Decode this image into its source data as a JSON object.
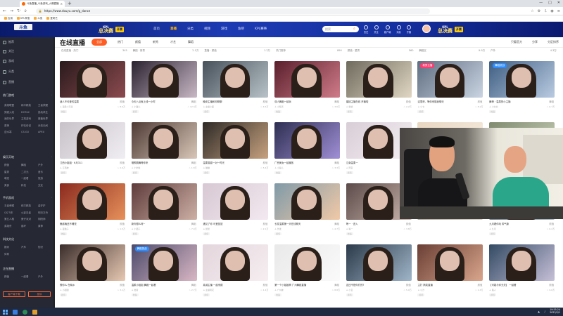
{
  "browser": {
    "tab_title": "斗鱼直播_斗鱼游戏_火爆直播",
    "url": "https://www.douyu.com/g_dance",
    "bookmarks": [
      "应用",
      "KPL押宝",
      "斗鱼",
      "爱奇艺"
    ]
  },
  "header": {
    "logo": "斗鱼",
    "room_number": "69190",
    "kpl_left": {
      "line1": "KPL",
      "line2": "总决赛",
      "tag": "开赛"
    },
    "kpl_right": {
      "line1": "KPL",
      "line2": "总决赛",
      "tag": "开赛"
    },
    "nav": [
      "首页",
      "直播",
      "分类",
      "视频",
      "游戏",
      "鱼吧",
      "KPL赛事"
    ],
    "active_nav": "直播",
    "search_placeholder": "搜索",
    "icons": [
      "历史",
      "关注",
      "客户端",
      "消息",
      "开播"
    ]
  },
  "sidebar": {
    "items": [
      "推荐",
      "关注",
      "游戏",
      "分类",
      "直播"
    ],
    "sections": [
      {
        "title": "热门游戏",
        "cells": [
          "英雄联盟",
          "和平精英",
          "王者荣耀",
          "穿越火线",
          "DOTA2",
          "绝地求生",
          "我的世界",
          "主机游戏",
          "魔兽世界",
          "原神",
          "炉石传说",
          "永劫无间",
          "逆水寒",
          "CS:GO",
          "APEX"
        ]
      },
      {
        "title": "娱乐天地",
        "cells": [
          "颜值",
          "舞蹈",
          "户外",
          "星秀",
          "二次元",
          "音乐",
          "萌宠",
          "一起看",
          "旅游",
          "美食",
          "科技",
          "交友"
        ]
      },
      {
        "title": "手机游戏",
        "cells": [
          "王者荣耀",
          "和平精英",
          "金铲铲",
          "QQ飞车",
          "火影忍者",
          "明日方舟",
          "第五人格",
          "蛋仔派对",
          "阴阳师",
          "英雄杀",
          "崩坏",
          "原神"
        ]
      },
      {
        "title": "科技文化",
        "cells": [
          "数码",
          "汽车",
          "知识",
          "体育"
        ]
      },
      {
        "title": "正在直播",
        "cells": [
          "颜值",
          "一起看",
          "户外"
        ]
      }
    ],
    "buttons": [
      "客户端下载",
      "投诉"
    ]
  },
  "main": {
    "title": "在线直播",
    "filters": [
      "全部",
      "热门",
      "颜值",
      "新秀",
      "才艺",
      "舞蹈"
    ],
    "active_filter": "全部",
    "right_actions": [
      "只看官方",
      "分享",
      "分区排序"
    ],
    "top_row": [
      {
        "a": "在线直播 · 热门",
        "b": "345"
      },
      {
        "a": "舞蹈 · 新秀",
        "b": "2.1万"
      },
      {
        "a": "直播 · 颜值",
        "b": "1.2万"
      },
      {
        "a": "热门推荐",
        "b": "890"
      },
      {
        "a": "颜值 · 星秀",
        "b": "560"
      },
      {
        "a": "舞蹈区",
        "b": "9.9万"
      },
      {
        "a": "户外",
        "b": "4.3万"
      }
    ],
    "cards": [
      {
        "title": "迷人不可爱的温柔",
        "tag": "颜值",
        "anchor": "温柔小可爱",
        "viewers": "8.6万",
        "label": "舞蹈",
        "badge": "",
        "c1": "#2a1a1c",
        "c2": "#8c4b4f"
      },
      {
        "title": "今天八点就上线一小时",
        "tag": "舞蹈",
        "anchor": "小甜心",
        "viewers": "12.3万",
        "label": "颜值",
        "badge": "",
        "c1": "#2a2230",
        "c2": "#c9b8c6"
      },
      {
        "title": "晚安主播和你聊聊",
        "tag": "颜值",
        "anchor": "主播小鹿",
        "viewers": "4.5万",
        "label": "颜值",
        "badge": "",
        "c1": "#46515a",
        "c2": "#b8c2c8"
      },
      {
        "title": "双人舞蹈一起玩",
        "tag": "舞蹈",
        "anchor": "小晴天",
        "viewers": "3.6万",
        "label": "舞蹈",
        "badge": "",
        "c1": "#5a1f2c",
        "c2": "#d07b89"
      },
      {
        "title": "蜜桃主播在线 开播啦",
        "tag": "颜值",
        "anchor": "蜜桃",
        "viewers": "2.2万",
        "label": "颜值",
        "badge": "",
        "c1": "#6e6a5d",
        "c2": "#e0d6c2"
      },
      {
        "title": "这里呀，等你来陪我聊天",
        "tag": "颜值",
        "anchor": "小七",
        "viewers": "8.1万",
        "label": "颜值",
        "badge": "新秀主播",
        "c1": "#5f6e82",
        "c2": "#cad4e2"
      },
      {
        "title": "舞神 · 温柔的小主播",
        "tag": "舞蹈",
        "anchor": "小北北",
        "viewers": "6.7万",
        "label": "舞蹈",
        "badge": "舞蹈挑战",
        "c1": "#3f5e83",
        "c2": "#b9cbe1"
      },
      {
        "title": "江西小姐姐 · 6月311",
        "tag": "颜值",
        "anchor": "江西妹",
        "viewers": "2.9万",
        "label": "颜值",
        "badge": "",
        "c1": "#c7c2c8",
        "c2": "#f1eef3"
      },
      {
        "title": "唱歌跳舞等你来",
        "tag": "舞蹈",
        "anchor": "小米粒",
        "viewers": "1.8万",
        "label": "颜值",
        "badge": "",
        "c1": "#4e3a34",
        "c2": "#d9c7b8"
      },
      {
        "title": "温柔猫猫一对一时光",
        "tag": "颜值",
        "anchor": "猫猫",
        "viewers": "5.4万",
        "label": "颜值",
        "badge": "",
        "c1": "#2e2a27",
        "c2": "#c7a27f"
      },
      {
        "title": "广西美女一起播放",
        "tag": "舞蹈",
        "anchor": "小鱼儿",
        "viewers": "3.3万",
        "label": "舞蹈",
        "badge": "",
        "c1": "#2d2e51",
        "c2": "#a08fd6"
      },
      {
        "title": "江南温柔一",
        "tag": "颜值",
        "anchor": "阿宝",
        "viewers": "2.6万",
        "label": "颜值",
        "badge": "",
        "c1": "#d8cfd6",
        "c2": "#f4eef2"
      },
      {
        "title": "",
        "tag": "",
        "anchor": "",
        "viewers": "",
        "label": "",
        "badge": "",
        "c1": "#e8d7c2",
        "c2": "#f5ece0"
      },
      {
        "title": "",
        "tag": "",
        "anchor": "",
        "viewers": "",
        "label": "",
        "badge": "",
        "c1": "#7f8a6e",
        "c2": "#c9d0b9"
      },
      {
        "title": "魅惑晚还不睡觉",
        "tag": "颜值",
        "anchor": "夜猫子",
        "viewers": "1.5万",
        "label": "舞蹈",
        "badge": "",
        "c1": "#8a2a1f",
        "c2": "#e7915b"
      },
      {
        "title": "新你想么呀~",
        "tag": "舞蹈",
        "anchor": "小团子",
        "viewers": "7.9万",
        "label": "颜值",
        "badge": "",
        "c1": "#5e3b3a",
        "c2": "#ceb0a6"
      },
      {
        "title": "遇见了你 可爱鼠鼠",
        "tag": "颜值",
        "anchor": "鼠鼠",
        "viewers": "2.1万",
        "label": "颜值",
        "badge": "",
        "c1": "#d7c8d3",
        "c2": "#f3e9f0"
      },
      {
        "title": "长发温柔第一天在线聊天",
        "tag": "舞蹈",
        "anchor": "长发",
        "viewers": "4.7万",
        "label": "颜值",
        "badge": "",
        "c1": "#7f9aa8",
        "c2": "#f1c9a7"
      },
      {
        "title": "等一 · 进入",
        "tag": "颜值",
        "anchor": "等一",
        "viewers": "3.8万",
        "label": "舞蹈",
        "badge": "",
        "c1": "#5b4b49",
        "c2": "#cab4ac"
      },
      {
        "title": "",
        "tag": "",
        "anchor": "",
        "viewers": "",
        "label": "",
        "badge": "",
        "c1": "#9a9488",
        "c2": "#d6d0c4"
      },
      {
        "title": "九月看你玩 带气象",
        "tag": "颜值",
        "anchor": "九月",
        "viewers": "6.2万",
        "label": "颜值",
        "badge": "",
        "c1": "#53626c",
        "c2": "#aebbc4"
      },
      {
        "title": "想你么 在嘛乡",
        "tag": "颜值",
        "anchor": "小甜甜",
        "viewers": "3.1万",
        "label": "颜值",
        "badge": "",
        "c1": "#3a2d2b",
        "c2": "#e8c9b3"
      },
      {
        "title": "温柔小姐姐 舞蹈一起看",
        "tag": "舞蹈",
        "anchor": "舞者",
        "viewers": "2.7万",
        "label": "舞蹈",
        "badge": "舞蹈挑战",
        "c1": "#4c4a6b",
        "c2": "#d9b7c4"
      },
      {
        "title": "真诚主播 一起来跳",
        "tag": "颜值",
        "anchor": "主播阿花",
        "viewers": "1.4万",
        "label": "颜值",
        "badge": "",
        "c1": "#e3d6dc",
        "c2": "#f6eef1"
      },
      {
        "title": "第一个小姐姐啊 广州舞蹈直播",
        "tag": "舞蹈",
        "anchor": "广州妹",
        "viewers": "8.8万",
        "label": "舞蹈",
        "badge": "",
        "c1": "#e9e9ea",
        "c2": "#fafafa"
      },
      {
        "title": "这还不是你们的?",
        "tag": "颜值",
        "anchor": "小宝",
        "viewers": "5.0万",
        "label": "颜值",
        "badge": "",
        "c1": "#2b3a4a",
        "c2": "#9fb5c8"
      },
      {
        "title": "主打 搞笑直播",
        "tag": "颜值",
        "anchor": "小汐",
        "viewers": "2.3万",
        "label": "颜值",
        "badge": "",
        "c1": "#6a3f35",
        "c2": "#d9a58c"
      },
      {
        "title": "【可能与你无关】 一起看",
        "tag": "颜值",
        "anchor": "路人",
        "viewers": "9.6万",
        "label": "颜值",
        "badge": "",
        "c1": "#334a63",
        "c2": "#c6c0d8"
      }
    ]
  },
  "taskbar": {
    "time": "19:55:24",
    "date": "2023/2/1"
  },
  "colors": {
    "accent": "#ff5d23",
    "nav_bg": "#1d3bb3",
    "sidebar_bg": "#262833"
  }
}
